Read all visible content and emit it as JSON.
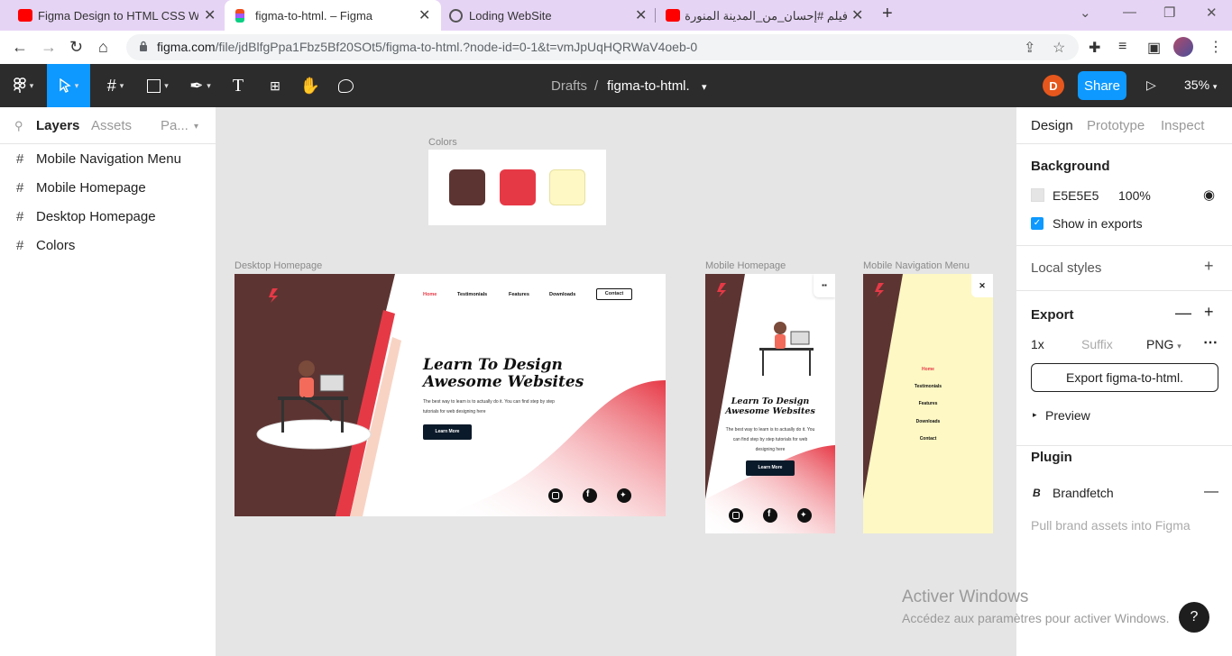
{
  "browser": {
    "tabs": [
      {
        "title": "Figma Design to HTML CSS Web"
      },
      {
        "title": "figma-to-html. – Figma"
      },
      {
        "title": "Loding WebSite"
      },
      {
        "title": "فيلم #إحسان_من_المدينة المنورة مع"
      }
    ],
    "url_host": "figma.com",
    "url_path": "/file/jdBlfgPpa1Fbz5Bf20SOt5/figma-to-html.?node-id=0-1&t=vmJpUqHQRWaV4oeb-0"
  },
  "toolbar": {
    "breadcrumb_parent": "Drafts",
    "breadcrumb_sep": "/",
    "file_name": "figma-to-html.",
    "user_initial": "D",
    "share_label": "Share",
    "zoom": "35%"
  },
  "left_panel": {
    "tabs": [
      "Layers",
      "Assets",
      "Pa..."
    ],
    "layers": [
      "Mobile Navigation Menu",
      "Mobile Homepage",
      "Desktop Homepage",
      "Colors"
    ]
  },
  "canvas": {
    "frame_labels": {
      "colors": "Colors",
      "desktop": "Desktop Homepage",
      "mobile": "Mobile Homepage",
      "mobile_nav": "Mobile Navigation Menu"
    },
    "palette": [
      "#5c3432",
      "#e63946",
      "#fdf8c4"
    ],
    "desktop": {
      "nav": [
        "Home",
        "Testimonials",
        "Features",
        "Downloads"
      ],
      "contact": "Contact",
      "headline_1": "Learn To Design",
      "headline_2": "Awesome Websites",
      "body_1": "The best way to learn is to actually do it. You can find step by step",
      "body_2": "tutorials for web designing here",
      "cta": "Learn More"
    },
    "mobile": {
      "headline_1": "Learn To Design",
      "headline_2": "Awesome Websites",
      "body_1": "The best way to learn is to actually do it. You",
      "body_2": "can find step by step tutorials for web",
      "body_3": "designing here",
      "cta": "Learn More"
    },
    "mobile_nav": {
      "items": [
        "Home",
        "Testimonials",
        "Features",
        "Downloads",
        "Contact"
      ]
    }
  },
  "right_panel": {
    "tabs": [
      "Design",
      "Prototype",
      "Inspect"
    ],
    "background_title": "Background",
    "background_hex": "E5E5E5",
    "background_opacity": "100%",
    "show_in_exports": "Show in exports",
    "local_styles": "Local styles",
    "export_title": "Export",
    "export_scale": "1x",
    "export_suffix_placeholder": "Suffix",
    "export_format": "PNG",
    "export_button": "Export figma-to-html.",
    "preview": "Preview",
    "plugin_title": "Plugin",
    "plugin_name": "Brandfetch",
    "plugin_desc": "Pull brand assets into Figma"
  },
  "watermark": {
    "line1": "Activer Windows",
    "line2": "Accédez aux paramètres pour activer Windows."
  },
  "help": "?"
}
